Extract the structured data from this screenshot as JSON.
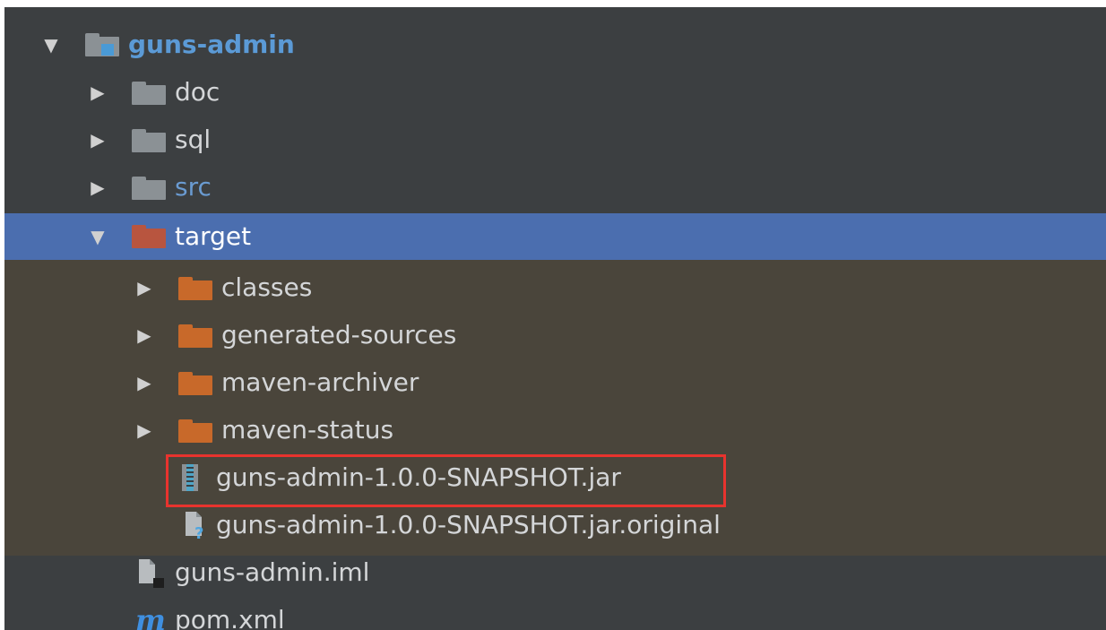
{
  "colors": {
    "panel_bg": "#3c3f41",
    "selection": "#4b6eaf",
    "excluded_bg": "#4a453b",
    "folder_gray": "#8b9195",
    "folder_orange": "#c8692a",
    "folder_target": "#b8553f",
    "text": "#d4d6d8",
    "text_src": "#6a9bd1",
    "highlight_border": "#e8332e"
  },
  "tree": {
    "root": {
      "label": "guns-admin",
      "expanded": true,
      "icon": "module-folder-icon"
    },
    "items": [
      {
        "label": "doc",
        "expanded": false,
        "icon": "folder-icon"
      },
      {
        "label": "sql",
        "expanded": false,
        "icon": "folder-icon"
      },
      {
        "label": "src",
        "expanded": false,
        "icon": "source-folder-icon"
      },
      {
        "label": "target",
        "expanded": true,
        "selected": true,
        "icon": "excluded-folder-icon"
      },
      {
        "label": "classes",
        "expanded": false,
        "icon": "excluded-folder-icon"
      },
      {
        "label": "generated-sources",
        "expanded": false,
        "icon": "excluded-folder-icon"
      },
      {
        "label": "maven-archiver",
        "expanded": false,
        "icon": "excluded-folder-icon"
      },
      {
        "label": "maven-status",
        "expanded": false,
        "icon": "excluded-folder-icon"
      },
      {
        "label": "guns-admin-1.0.0-SNAPSHOT.jar",
        "icon": "jar-archive-icon",
        "highlighted": true
      },
      {
        "label": "guns-admin-1.0.0-SNAPSHOT.jar.original",
        "icon": "unknown-file-icon"
      },
      {
        "label": "guns-admin.iml",
        "icon": "iml-file-icon"
      },
      {
        "label": "pom.xml",
        "icon": "maven-pom-icon"
      }
    ]
  }
}
